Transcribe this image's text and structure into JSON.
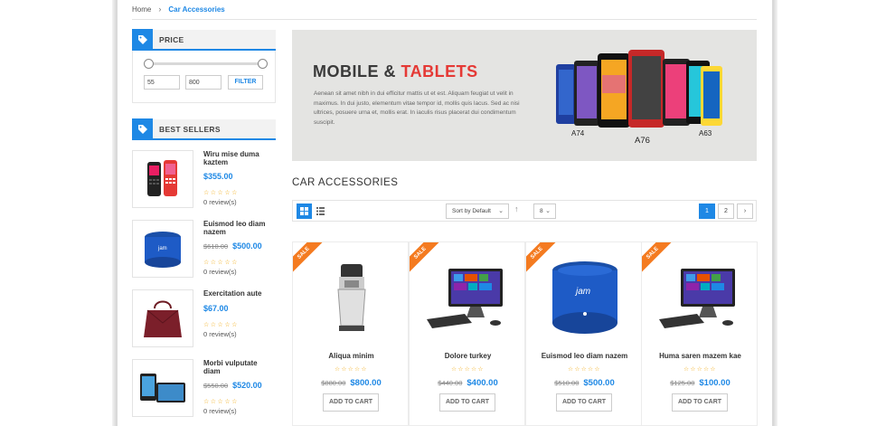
{
  "breadcrumb": {
    "home": "Home",
    "separator": "›",
    "current": "Car Accessories"
  },
  "price_filter": {
    "title": "PRICE",
    "min": "55",
    "max": "800",
    "filter_label": "FILTER",
    "icon": "tag-icon"
  },
  "best_sellers": {
    "title": "BEST SELLERS",
    "items": [
      {
        "name": "Wiru mise duma kaztem",
        "old_price": "",
        "price": "$355.00",
        "stars": "☆☆☆☆☆",
        "reviews": "0 review(s)"
      },
      {
        "name": "Euismod leo diam nazem",
        "old_price": "$610.00",
        "price": "$500.00",
        "stars": "☆☆☆☆☆",
        "reviews": "0 review(s)"
      },
      {
        "name": "Exercitation aute",
        "old_price": "",
        "price": "$67.00",
        "stars": "☆☆☆☆☆",
        "reviews": "0 review(s)"
      },
      {
        "name": "Morbi vulputate diam",
        "old_price": "$550.00",
        "price": "$520.00",
        "stars": "☆☆☆☆☆",
        "reviews": "0 review(s)"
      }
    ]
  },
  "banner": {
    "title_a": "MOBILE & ",
    "title_b": "TABLETS",
    "text": "Aenean sit amet nibh in dui efficitur mattis ut et est. Aliquam feugiat ut velit in maximus. In dui justo, elementum vitae tempor id, mollis quis lacus. Sed ac nisi ultrices, posuere urna et, mollis erat. In iaculis risus placerat dui condimentum suscipit.",
    "labels": [
      "A74",
      "A76",
      "A63"
    ]
  },
  "section": {
    "title": "CAR ACCESSORIES"
  },
  "toolbar": {
    "sort": "Sort by Default",
    "limit": "8",
    "pages": [
      "1",
      "2",
      "›"
    ]
  },
  "products": [
    {
      "name": "Aliqua minim",
      "old_price": "$880.00",
      "price": "$800.00",
      "stars": "☆☆☆☆☆",
      "button": "ADD TO CART",
      "badge": "SALE"
    },
    {
      "name": "Dolore turkey",
      "old_price": "$440.00",
      "price": "$400.00",
      "stars": "☆☆☆☆☆",
      "button": "ADD TO CART",
      "badge": "SALE"
    },
    {
      "name": "Euismod leo diam nazem",
      "old_price": "$510.00",
      "price": "$500.00",
      "stars": "☆☆☆☆☆",
      "button": "ADD TO CART",
      "badge": "SALE"
    },
    {
      "name": "Huma saren mazem kae",
      "old_price": "$125.00",
      "price": "$100.00",
      "stars": "☆☆☆☆☆",
      "button": "ADD TO CART",
      "badge": "SALE"
    }
  ],
  "colors": {
    "accent": "#1e88e5",
    "sale": "#f47b20",
    "banner_red": "#e53935"
  }
}
